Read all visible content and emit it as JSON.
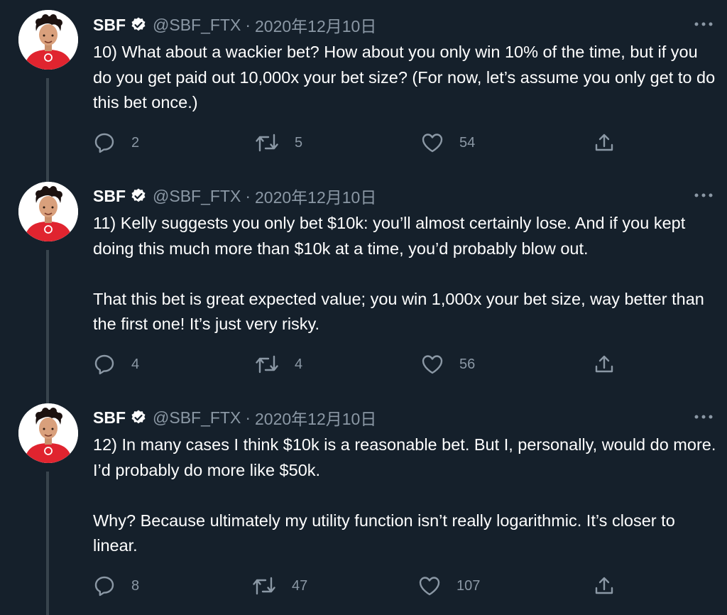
{
  "tweets": [
    {
      "name": "SBF",
      "handle": "@SBF_FTX",
      "separator": "·",
      "date": "2020年12月10日",
      "paragraphs": [
        "10) What about a wackier bet?  How about you only win 10% of the time, but if you do you get paid out 10,000x your bet size?  (For now, let’s assume you only get to do this bet once.)"
      ],
      "replies": "2",
      "retweets": "5",
      "likes": "54"
    },
    {
      "name": "SBF",
      "handle": "@SBF_FTX",
      "separator": "·",
      "date": "2020年12月10日",
      "paragraphs": [
        "11) Kelly suggests you only bet $10k: you’ll almost certainly lose.  And if you kept doing this much more than $10k at a time, you’d probably blow out.",
        "That this bet is great expected value; you win 1,000x your bet size, way better than the first one!  It’s just very risky."
      ],
      "replies": "4",
      "retweets": "4",
      "likes": "56"
    },
    {
      "name": "SBF",
      "handle": "@SBF_FTX",
      "separator": "·",
      "date": "2020年12月10日",
      "paragraphs": [
        "12) In many cases I think $10k is a reasonable bet.  But I, personally, would do more.  I’d probably do more like $50k.",
        "Why?  Because ultimately my utility function isn’t really logarithmic.  It’s closer to linear."
      ],
      "replies": "8",
      "retweets": "47",
      "likes": "107"
    }
  ],
  "icons": {
    "verified": "verified-badge-icon",
    "more": "more-dots-icon",
    "reply": "reply-bubble-icon",
    "retweet": "retweet-arrows-icon",
    "like": "heart-icon",
    "share": "share-upload-icon"
  },
  "colors": {
    "background": "#15202b",
    "text": "#ffffff",
    "muted": "#8b98a5",
    "thread_line": "#38444d",
    "shirt": "#e0242f"
  }
}
